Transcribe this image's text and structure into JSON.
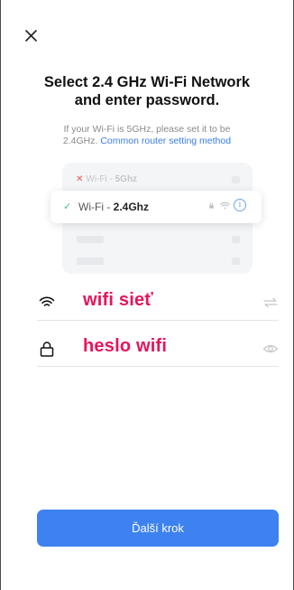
{
  "header": {
    "close_icon": "close-icon"
  },
  "title": {
    "line1": "Select 2.4 GHz Wi-Fi Network",
    "line2": "and enter password."
  },
  "subtitle": {
    "text_line1": "If your Wi-Fi is 5GHz, please set it to be",
    "text_line2_prefix": "2.4GHz.",
    "link": "Common router setting method"
  },
  "illustration": {
    "row_5g_prefix": "Wi-Fi - ",
    "row_5g_band": "5Ghz",
    "row_24_prefix": "Wi-Fi - ",
    "row_24_band": "2.4Ghz"
  },
  "form": {
    "network_value": "wifi sieť",
    "password_value": "heslo wifi",
    "network_icon": "wifi-icon",
    "password_icon": "lock-icon",
    "switch_icon": "switch-network-icon",
    "eye_icon": "eye-icon"
  },
  "next_button": {
    "label": "Ďalší krok"
  },
  "colors": {
    "accent": "#3d82f0",
    "value_text": "#e6145c",
    "link": "#3b7ce6"
  }
}
